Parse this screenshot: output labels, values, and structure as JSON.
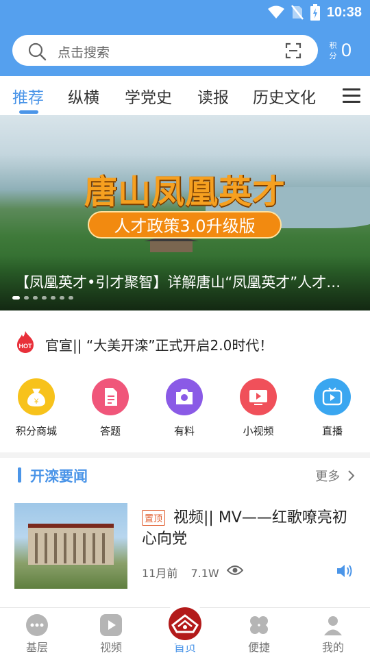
{
  "status_bar": {
    "time": "10:38"
  },
  "search": {
    "placeholder": "点击搜索"
  },
  "points": {
    "label": "积分",
    "value": "0"
  },
  "tabs": [
    {
      "label": "推荐",
      "active": true
    },
    {
      "label": "纵横"
    },
    {
      "label": "学党史"
    },
    {
      "label": "读报"
    },
    {
      "label": "历史文化"
    }
  ],
  "banner": {
    "title": "唐山凤凰英才",
    "subtitle": "人才政策3.0升级版",
    "caption": "【凤凰英才•引才聚智】详解唐山“凤凰英才”人才…",
    "dot_count": 7,
    "active_dot": 0
  },
  "hot": {
    "badge": "HOT",
    "text": "官宣|| “大美开滦”正式开启2.0时代！"
  },
  "quick_links": [
    {
      "label": "积分商城",
      "icon": "money-bag-icon",
      "color": "#f7c21b"
    },
    {
      "label": "答题",
      "icon": "document-icon",
      "color": "#f0567a"
    },
    {
      "label": "有料",
      "icon": "camera-icon",
      "color": "#8a5ae6"
    },
    {
      "label": "小视频",
      "icon": "tv-play-icon",
      "color": "#f0505a"
    },
    {
      "label": "直播",
      "icon": "live-tv-icon",
      "color": "#3aa6f0"
    }
  ],
  "section": {
    "title": "开滦要闻",
    "more": "更多"
  },
  "news": [
    {
      "tag": "置顶",
      "title": "视频|| MV——红歌嘹亮初心向党",
      "time": "11月前",
      "views": "7.1W"
    }
  ],
  "bottom_nav": [
    {
      "label": "基层",
      "icon": "chat-dots-icon"
    },
    {
      "label": "视频",
      "icon": "play-icon"
    },
    {
      "label": "首页",
      "icon": "home-logo-icon",
      "active": true
    },
    {
      "label": "便捷",
      "icon": "clover-icon"
    },
    {
      "label": "我的",
      "icon": "user-icon"
    }
  ],
  "colors": {
    "brand_blue": "#55a0ee",
    "accent_blue": "#4b95e8",
    "banner_orange": "#f6a020"
  }
}
